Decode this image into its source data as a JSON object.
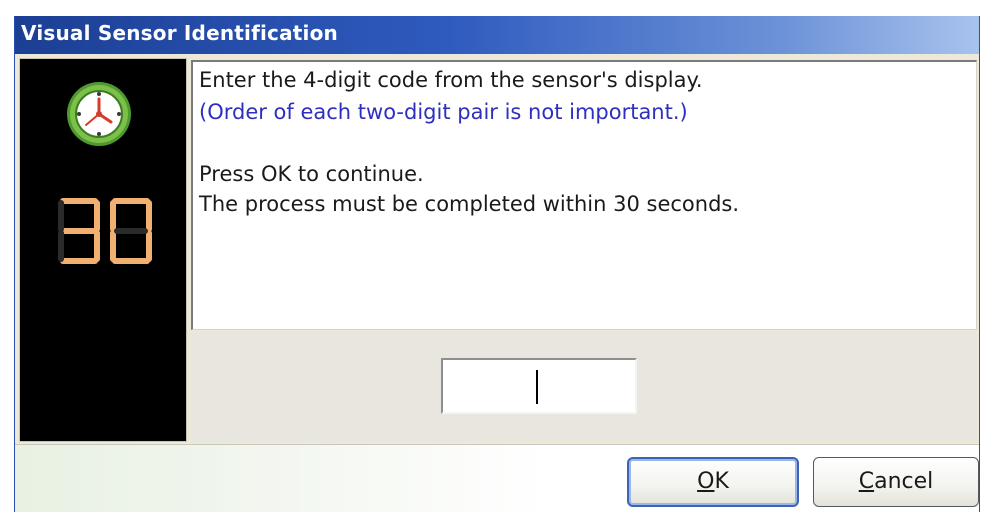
{
  "window": {
    "title": "Visual Sensor Identification"
  },
  "sidebar": {
    "icon": "clock-icon",
    "countdown": "30"
  },
  "message": {
    "line1": "Enter the 4-digit code from the sensor's display.",
    "line2": "(Order of each two-digit pair is not important.)",
    "line3": "Press OK to continue.",
    "line4": "The process must be completed within 30 seconds."
  },
  "code_input": {
    "value": ""
  },
  "buttons": {
    "ok_mnemonic": "O",
    "ok_rest": "K",
    "cancel_mnemonic": "C",
    "cancel_rest": "ancel"
  },
  "colors": {
    "title_bar": "#2f5bbf",
    "note_text": "#2f2fbf",
    "timer_digits": "#f0b070"
  }
}
